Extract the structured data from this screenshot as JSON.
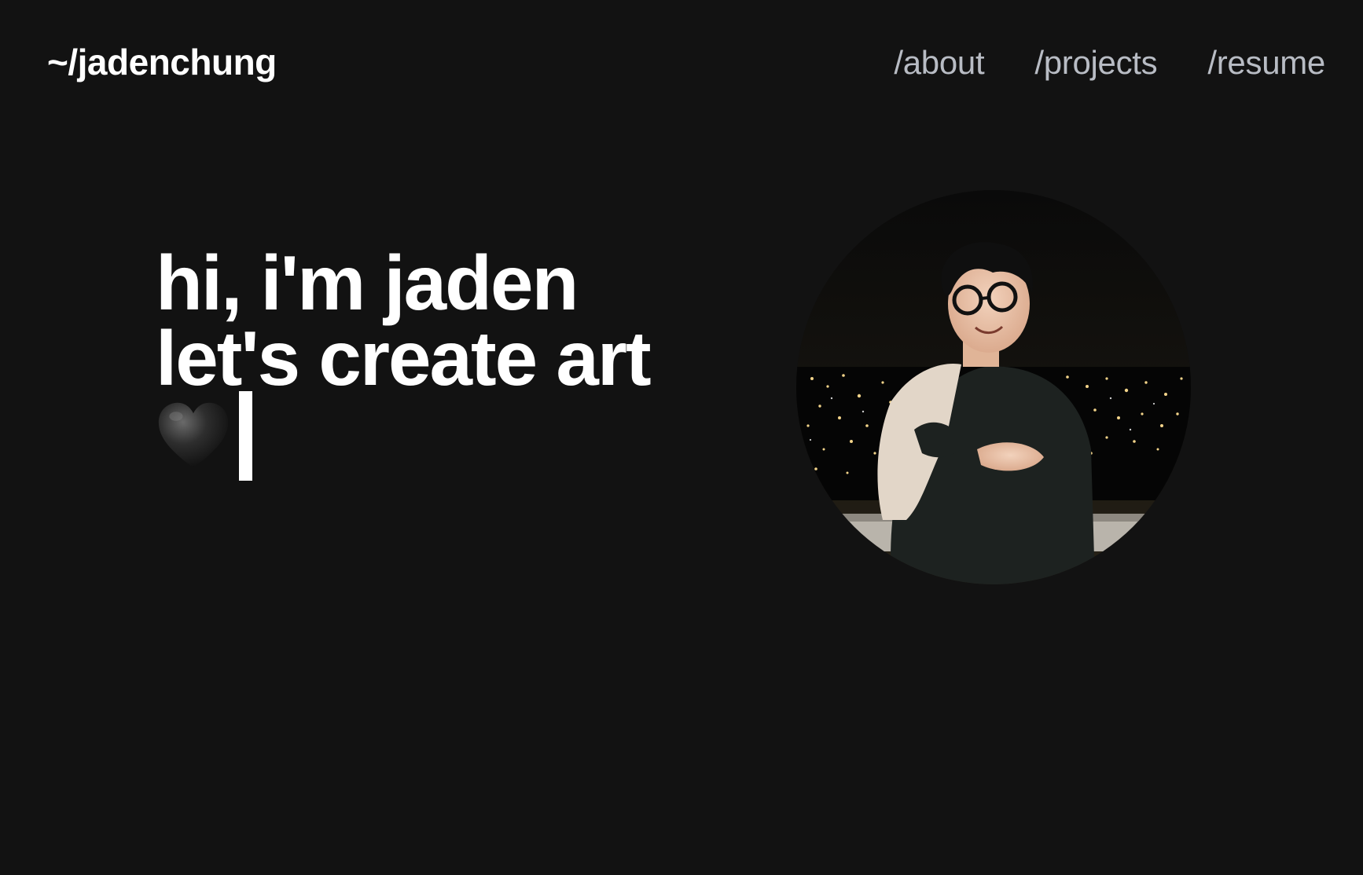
{
  "header": {
    "logo_text": "~/jadenchung",
    "nav": [
      {
        "label": "/about"
      },
      {
        "label": "/projects"
      },
      {
        "label": "/resume"
      }
    ]
  },
  "hero": {
    "line1": "hi, i'm jaden",
    "line2": "let's create art",
    "emoji_icon": "black-heart-icon"
  },
  "colors": {
    "background": "#121212",
    "text": "#ffffff",
    "nav_text": "#b8bcc4"
  }
}
